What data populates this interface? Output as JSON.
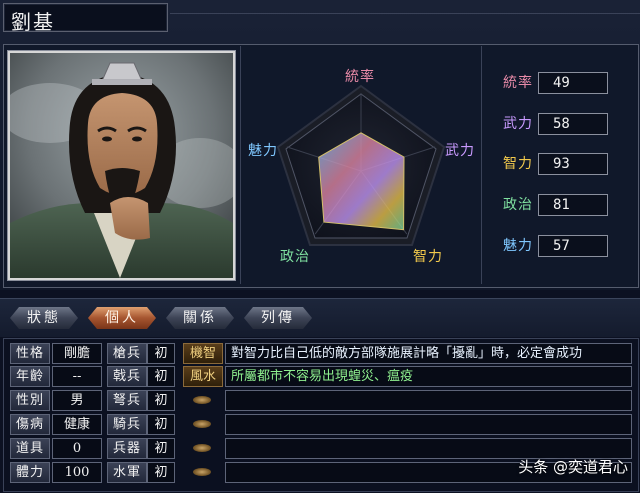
{
  "character": {
    "name": "劉基"
  },
  "stats": [
    {
      "label": "統率",
      "value": "49",
      "color": "#e88aa8"
    },
    {
      "label": "武力",
      "value": "58",
      "color": "#c99aff"
    },
    {
      "label": "智力",
      "value": "93",
      "color": "#f2c94c"
    },
    {
      "label": "政治",
      "value": "81",
      "color": "#7fe0a0"
    },
    {
      "label": "魅力",
      "value": "57",
      "color": "#7fc7ff"
    }
  ],
  "radar_labels": {
    "leadership": "統率",
    "war": "武力",
    "intelligence": "智力",
    "politics": "政治",
    "charm": "魅力"
  },
  "radar_values": {
    "max": 100,
    "order": [
      "統率",
      "武力",
      "智力",
      "政治",
      "魅力"
    ],
    "values": [
      49,
      58,
      93,
      81,
      57
    ]
  },
  "tabs": [
    {
      "label": "狀態",
      "active": false
    },
    {
      "label": "個人",
      "active": true
    },
    {
      "label": "關係",
      "active": false
    },
    {
      "label": "列傳",
      "active": false
    }
  ],
  "attributes": [
    {
      "label": "性格",
      "value": "剛膽"
    },
    {
      "label": "年齡",
      "value": "--"
    },
    {
      "label": "性別",
      "value": "男"
    },
    {
      "label": "傷病",
      "value": "健康"
    },
    {
      "label": "道具",
      "value": "0"
    },
    {
      "label": "體力",
      "value": "100"
    }
  ],
  "troops": [
    {
      "label": "槍兵",
      "value": "初"
    },
    {
      "label": "戟兵",
      "value": "初"
    },
    {
      "label": "弩兵",
      "value": "初"
    },
    {
      "label": "騎兵",
      "value": "初"
    },
    {
      "label": "兵器",
      "value": "初"
    },
    {
      "label": "水軍",
      "value": "初"
    }
  ],
  "skills": [
    {
      "name": "機智",
      "description": "對智力比自己低的敵方部隊施展計略「擾亂」時，必定會成功",
      "desc_color": "#e8f2ff"
    },
    {
      "name": "風水",
      "description": "所屬都市不容易出現蝗災、瘟疫",
      "desc_color": "#8ff08f"
    },
    {
      "name": "",
      "description": ""
    },
    {
      "name": "",
      "description": ""
    },
    {
      "name": "",
      "description": ""
    },
    {
      "name": "",
      "description": ""
    }
  ],
  "watermark": "头条 @奕道君心",
  "icons": {
    "skill_gem": "gem-icon"
  }
}
